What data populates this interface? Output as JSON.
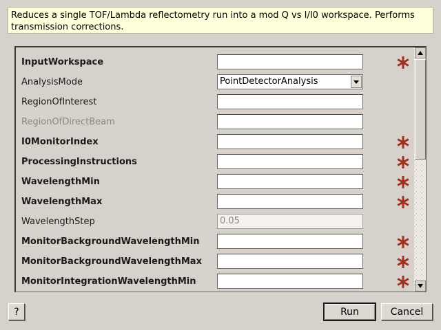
{
  "description": "Reduces a single TOF/Lambda reflectometry run into a mod Q vs I/I0 workspace. Performs transmission corrections.",
  "properties": [
    {
      "label": "InputWorkspace",
      "bold": true,
      "enabled": true,
      "kind": "text",
      "value": "",
      "mandatory": true
    },
    {
      "label": "AnalysisMode",
      "bold": false,
      "enabled": true,
      "kind": "combo",
      "value": "PointDetectorAnalysis",
      "mandatory": false
    },
    {
      "label": "RegionOfInterest",
      "bold": false,
      "enabled": true,
      "kind": "text",
      "value": "",
      "mandatory": false
    },
    {
      "label": "RegionOfDirectBeam",
      "bold": false,
      "enabled": false,
      "kind": "text",
      "value": "",
      "mandatory": false
    },
    {
      "label": "I0MonitorIndex",
      "bold": true,
      "enabled": true,
      "kind": "text",
      "value": "",
      "mandatory": true
    },
    {
      "label": "ProcessingInstructions",
      "bold": true,
      "enabled": true,
      "kind": "text",
      "value": "",
      "mandatory": true
    },
    {
      "label": "WavelengthMin",
      "bold": true,
      "enabled": true,
      "kind": "text",
      "value": "",
      "mandatory": true
    },
    {
      "label": "WavelengthMax",
      "bold": true,
      "enabled": true,
      "kind": "text",
      "value": "",
      "mandatory": true
    },
    {
      "label": "WavelengthStep",
      "bold": false,
      "enabled": true,
      "kind": "text",
      "value": "",
      "placeholder": "0.05",
      "mandatory": false
    },
    {
      "label": "MonitorBackgroundWavelengthMin",
      "bold": true,
      "enabled": true,
      "kind": "text",
      "value": "",
      "mandatory": true
    },
    {
      "label": "MonitorBackgroundWavelengthMax",
      "bold": true,
      "enabled": true,
      "kind": "text",
      "value": "",
      "mandatory": true
    },
    {
      "label": "MonitorIntegrationWavelengthMin",
      "bold": true,
      "enabled": true,
      "kind": "text",
      "value": "",
      "mandatory": true
    }
  ],
  "scroll_position": 0.0,
  "buttons": {
    "help_label": "?",
    "run_label": "Run",
    "cancel_label": "Cancel"
  },
  "colors": {
    "mandatory_star": "#a0301f",
    "description_bg": "#ffffdc",
    "window_bg": "#d6d2cb"
  },
  "icons": {
    "mandatory": "asterisk-icon",
    "combo_arrow": "triangle-down-icon",
    "scroll_up": "triangle-up-icon",
    "scroll_down": "triangle-down-icon"
  }
}
